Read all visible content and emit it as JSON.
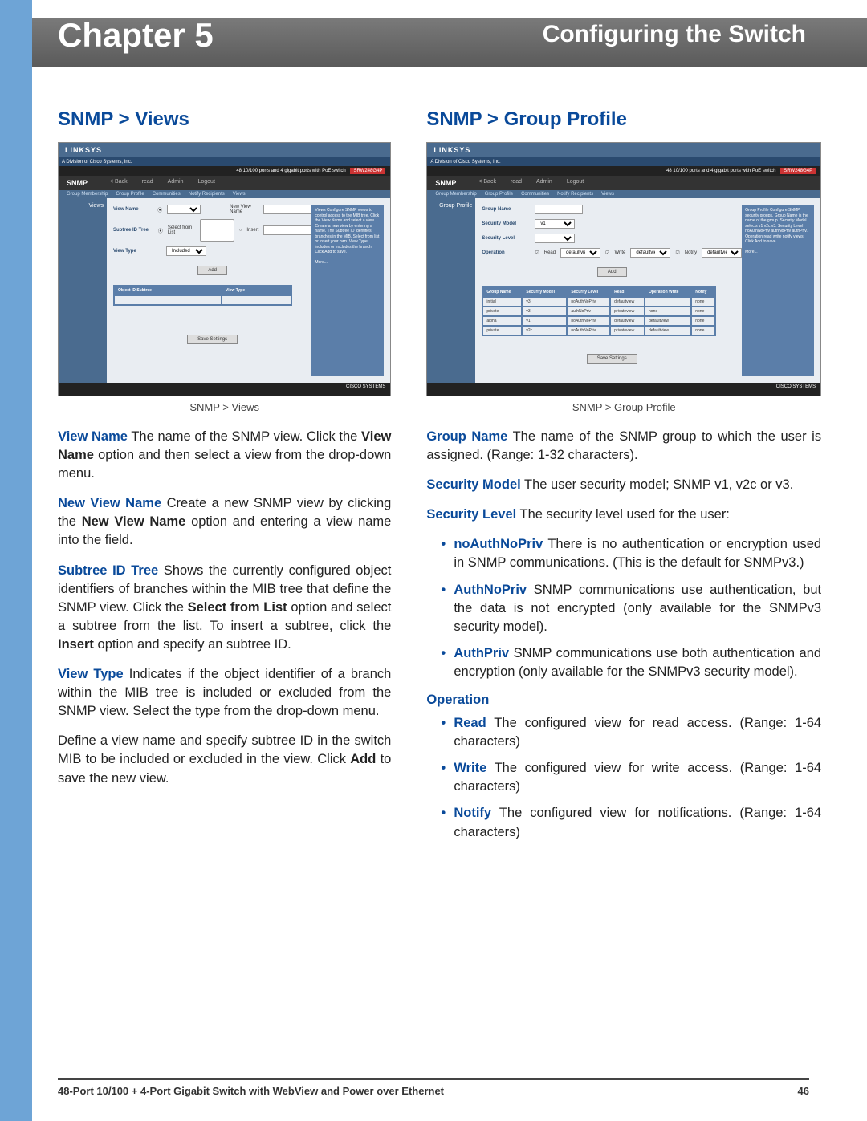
{
  "header": {
    "chapter": "Chapter 5",
    "title": "Configuring the Switch"
  },
  "left": {
    "heading": "SNMP > Views",
    "caption": "SNMP > Views",
    "screenshot": {
      "brand": "LINKSYS",
      "brand_sub": "A Division of Cisco Systems, Inc.",
      "model": "48 10/100 ports and 4 gigabit ports with PoE switch",
      "model_tag": "SRW248G4P",
      "main_tab": "SNMP",
      "nav": [
        "< Back",
        "read",
        "Admin",
        "Logout"
      ],
      "side_label": "Views",
      "fields": {
        "view_name_label": "View Name",
        "new_view_name_label": "New View Name",
        "subtree_label": "Subtree ID Tree",
        "select_from_list": "Select from List",
        "insert_opt": "Insert",
        "view_type_label": "View Type",
        "view_type_val": "Included",
        "add_btn": "Add"
      },
      "table_headers": [
        "Object ID Subtree",
        "View Type"
      ]
    },
    "paragraphs": [
      {
        "term": "View Name",
        "text": "  The name of the SNMP view. Click the ",
        "bold2": "View Name",
        "text2": " option and then select a view from the drop-down menu."
      },
      {
        "term": "New View Name",
        "text": "  Create a new SNMP view by clicking the ",
        "bold2": "New View Name",
        "text2": " option and entering a view name into the field."
      },
      {
        "term": "Subtree ID Tree",
        "text": "  Shows the currently configured object identifiers of branches within the MIB tree that define the SNMP view. Click the ",
        "bold2": "Select from List",
        "text2": " option and select a subtree from the list. To insert a subtree, click the ",
        "bold3": "Insert",
        "text3": " option and specify an subtree ID."
      },
      {
        "term": "View Type",
        "text": "  Indicates if the object identifier of a branch within the MIB tree is included or excluded from the SNMP view. Select the type from the drop-down menu."
      }
    ],
    "final": {
      "pre": "Define a view name and specify subtree ID in the switch MIB to be included or excluded in the view. Click ",
      "bold": "Add",
      "post": " to save the new view."
    }
  },
  "right": {
    "heading": "SNMP > Group Profile",
    "caption": "SNMP > Group Profile",
    "screenshot": {
      "brand": "LINKSYS",
      "brand_sub": "A Division of Cisco Systems, Inc.",
      "model": "48 10/100 ports and 4 gigabit ports with PoE switch",
      "model_tag": "SRW248G4P",
      "main_tab": "SNMP",
      "nav": [
        "< Back",
        "read",
        "Admin",
        "Logout"
      ],
      "side_label": "Group Profile",
      "fields": {
        "group_name_label": "Group Name",
        "security_model_label": "Security Model",
        "security_model_val": "v1",
        "security_level_label": "Security Level",
        "operation_label": "Operation",
        "op_read": "Read",
        "op_write": "Write",
        "op_notify": "Notify",
        "default_view": "defaultview",
        "add_btn": "Add"
      },
      "table_headers": [
        "Group Name",
        "Security Model",
        "Security Level",
        "Read",
        "Operation Write",
        "Notify"
      ],
      "rows": [
        [
          "initial",
          "v3",
          "noAuthNoPriv",
          "defaultview",
          "",
          "none"
        ],
        [
          "private",
          "v3",
          "authNoPriv",
          "privateview",
          "none",
          "none"
        ],
        [
          "alpha",
          "v1",
          "noAuthNoPriv",
          "defaultview",
          "defaultview",
          "none"
        ],
        [
          "private",
          "v2c",
          "noAuthNoPriv",
          "privateview",
          "defaultview",
          "none"
        ]
      ]
    },
    "paragraphs": [
      {
        "term": "Group Name",
        "text": "  The name of the SNMP group to which the user is assigned. (Range: 1-32 characters)."
      },
      {
        "term": "Security Model",
        "text": "  The user security model; SNMP v1, v2c or v3."
      },
      {
        "term": "Security Level",
        "text": "  The security level used for the user:"
      }
    ],
    "sec_bullets": [
      {
        "term": "noAuthNoPriv",
        "text": "  There is no authentication or encryption used in SNMP communications. (This is the default for SNMPv3.)"
      },
      {
        "term": "AuthNoPriv",
        "text": "  SNMP communications use authentication, but the data is not encrypted (only available for the SNMPv3 security model)."
      },
      {
        "term": "AuthPriv",
        "text": "  SNMP communications use both authentication and encryption (only available for the SNMPv3 security model)."
      }
    ],
    "op_head": "Operation",
    "op_bullets": [
      {
        "term": "Read",
        "text": "  The configured view for read access. (Range: 1-64 characters)"
      },
      {
        "term": "Write",
        "text": "  The configured view for write access. (Range: 1-64 characters)"
      },
      {
        "term": "Notify",
        "text": "  The configured view for notifications. (Range: 1-64 characters)"
      }
    ]
  },
  "footer": {
    "product": "48-Port 10/100 + 4-Port Gigabit Switch with WebView and Power over Ethernet",
    "page": "46"
  }
}
